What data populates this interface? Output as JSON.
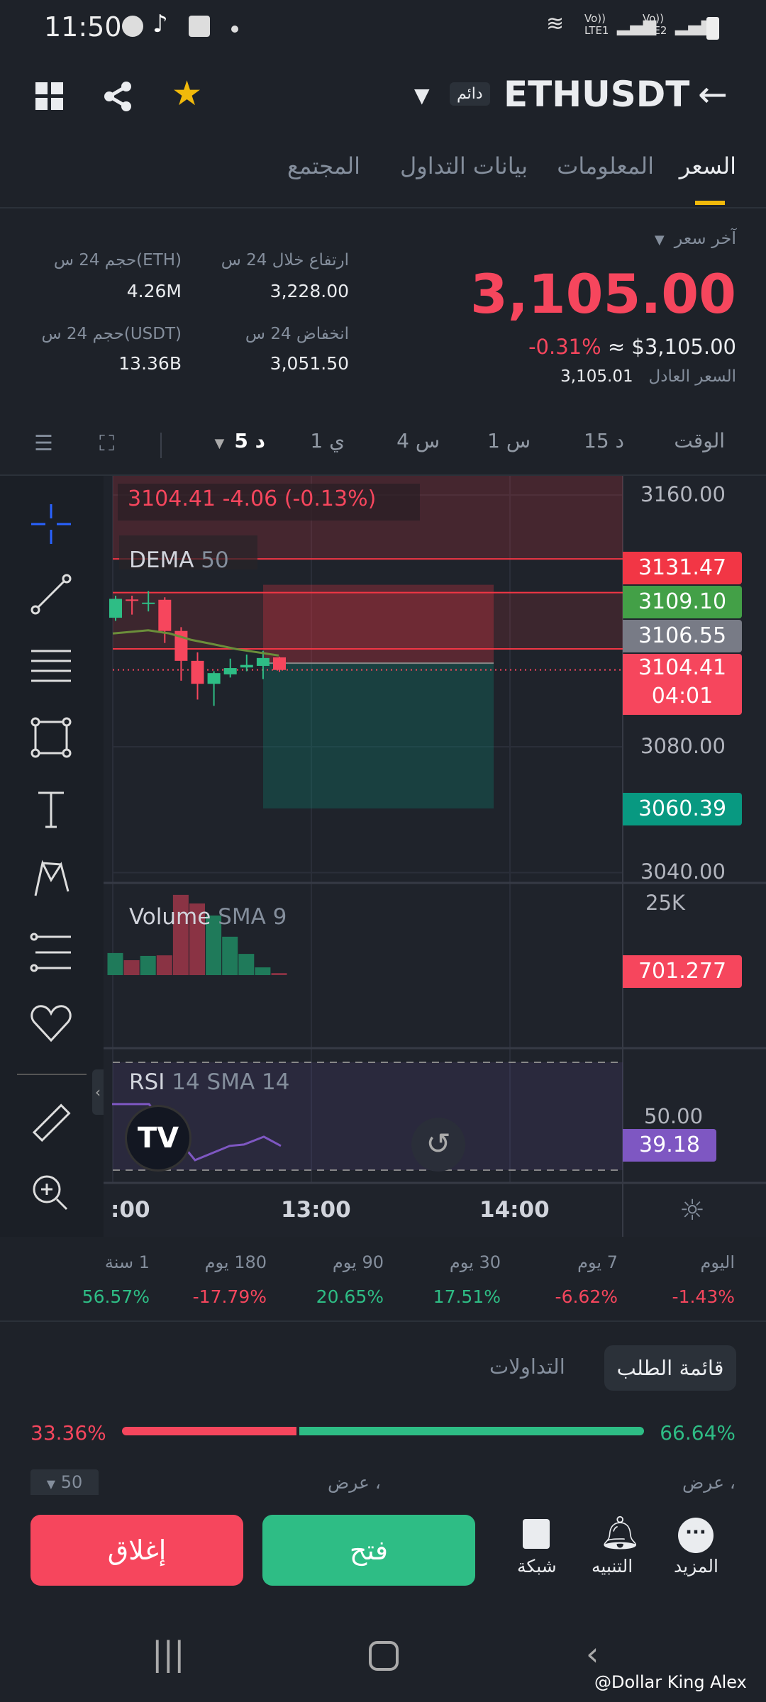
{
  "status": {
    "time": "11:50",
    "volte": "Vo))",
    "sim1": "LTE1",
    "sim2": "LTE2"
  },
  "header": {
    "symbol": "ETHUSDT",
    "badge": "دائم"
  },
  "tabs": [
    "السعر",
    "المعلومات",
    "بيانات التداول",
    "المجتمع"
  ],
  "price": {
    "last_label": "آخر سعر",
    "last": "3,105.00",
    "change": "-0.31%",
    "usd": "≈ $3,105.00",
    "fair_label": "السعر العادل",
    "fair": "3,105.01"
  },
  "stats": [
    {
      "label": "ارتفاع خلال 24 س",
      "value": "3,228.00"
    },
    {
      "label": "حجم 24 س(ETH)",
      "value": "4.26M"
    },
    {
      "label": "انخفاض 24 س",
      "value": "3,051.50"
    },
    {
      "label": "حجم 24 س(USDT)",
      "value": "13.36B"
    }
  ],
  "timeframes": {
    "label": "الوقت",
    "items": [
      "15 د",
      "1 س",
      "4 س",
      "1 ي"
    ],
    "active": "5 د"
  },
  "chart_data": {
    "type": "candlestick",
    "legend": {
      "ohlc": "3104.41  -4.06 (-0.13%)",
      "dema": "DEMA",
      "dema_param": "50",
      "volume": "Volume",
      "volume_param": "SMA 9",
      "rsi": "RSI",
      "rsi_param": "14 SMA 14"
    },
    "price_axis": [
      "3160.00",
      "3080.00",
      "3040.00"
    ],
    "price_tick_values": [
      3160,
      3080,
      3040
    ],
    "x_ticks": [
      ":00",
      "13:00",
      "14:00"
    ],
    "candles": [
      {
        "o": 3121,
        "h": 3128,
        "l": 3120,
        "c": 3127
      },
      {
        "o": 3126.8,
        "h": 3128,
        "l": 3122,
        "c": 3126.4
      },
      {
        "o": 3125.4,
        "h": 3129.5,
        "l": 3123,
        "c": 3125.8
      },
      {
        "o": 3126.7,
        "h": 3127.5,
        "l": 3113,
        "c": 3116.8
      },
      {
        "o": 3116.8,
        "h": 3118,
        "l": 3101,
        "c": 3107.3
      },
      {
        "o": 3107.3,
        "h": 3110,
        "l": 3095,
        "c": 3100
      },
      {
        "o": 3100,
        "h": 3104,
        "l": 3093,
        "c": 3103.4
      },
      {
        "o": 3103,
        "h": 3108,
        "l": 3102,
        "c": 3105
      },
      {
        "o": 3105.2,
        "h": 3109.3,
        "l": 3104,
        "c": 3106
      },
      {
        "o": 3105.7,
        "h": 3110.5,
        "l": 3101.5,
        "c": 3108.2
      },
      {
        "o": 3108.4,
        "h": 3108.6,
        "l": 3103.8,
        "c": 3104.41
      }
    ],
    "dema": [
      3116,
      3117,
      3116,
      3114,
      3112.7,
      3111,
      3109
    ],
    "markers": [
      {
        "label": "3131.47",
        "value": 3131.47,
        "color": "#f23645"
      },
      {
        "label": "3109.10",
        "value": 3109.1,
        "color": "#43a047"
      },
      {
        "label": "3106.55",
        "value": 3106.55,
        "color": "#787b86"
      },
      {
        "label": "3104.41",
        "sub": "04:01",
        "value": 3104.41,
        "color": "#f6465d"
      },
      {
        "label": "3060.39",
        "value": 3060.39,
        "color": "#089981"
      }
    ],
    "position": {
      "stop": 3131.47,
      "entry": 3106.55,
      "target": 3060.39
    },
    "lines": [
      3139.7,
      3129,
      3111.1
    ],
    "volume": {
      "axis": "25K",
      "last": "701.277",
      "values": [
        7700,
        5200,
        6700,
        6900,
        28000,
        25000,
        20800,
        13400,
        7400,
        2700,
        701
      ],
      "up": [
        true,
        false,
        true,
        false,
        false,
        false,
        true,
        true,
        true,
        true,
        false
      ]
    },
    "rsi": {
      "axis": "50.00",
      "last": "39.18",
      "values": [
        54.5,
        54.5,
        33.7,
        39,
        39.5,
        42.4,
        39
      ],
      "bands": [
        70,
        30
      ]
    }
  },
  "performance": [
    {
      "label": "اليوم",
      "value": "1.43%-",
      "up": false
    },
    {
      "label": "7 يوم",
      "value": "6.62%-",
      "up": false
    },
    {
      "label": "30 يوم",
      "value": "17.51%",
      "up": true
    },
    {
      "label": "90 يوم",
      "value": "20.65%",
      "up": true
    },
    {
      "label": "180 يوم",
      "value": "17.79%-",
      "up": false
    },
    {
      "label": "1 سنة",
      "value": "56.57%",
      "up": true
    }
  ],
  "orderbook": {
    "tabs": [
      "قائمة الطلب",
      "التداولات"
    ],
    "buy_pct": "66.64%",
    "sell_pct": "33.36%",
    "buy_fraction": 0.6664,
    "depth": "50",
    "col_bid": "عرض ،",
    "col_ask": "عرض ،"
  },
  "bottom": {
    "more": "المزيد",
    "alert": "التنبيه",
    "grid": "شبكة",
    "open": "فتح",
    "close": "إغلاق"
  },
  "watermark": "@Dollar King Alex",
  "colors": {
    "up": "#2ebd85",
    "down": "#f6465d",
    "accent": "#f0b90b"
  }
}
